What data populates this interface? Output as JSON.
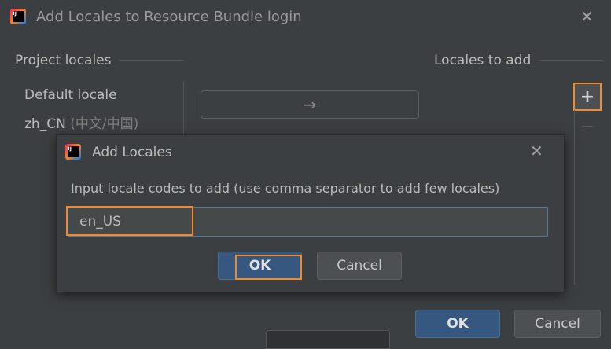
{
  "main_dialog": {
    "title": "Add Locales to Resource Bundle login",
    "close_icon": "close-icon",
    "project_locales_label": "Project locales",
    "locales_to_add_label": "Locales to add",
    "project_locales": [
      {
        "code": "Default locale",
        "native": ""
      },
      {
        "code": "zh_CN",
        "native": "(中文/中国)"
      }
    ],
    "arrow_glyph": "→",
    "plus_glyph": "+",
    "minus_glyph": "−",
    "ok_label": "OK",
    "cancel_label": "Cancel"
  },
  "sub_dialog": {
    "title": "Add Locales",
    "close_icon": "close-icon",
    "prompt": "Input locale codes to add (use comma separator to add few locales)",
    "input_value": "en_US",
    "ok_label": "OK",
    "cancel_label": "Cancel"
  },
  "logo_text": "IJ",
  "colors": {
    "background": "#3c3f41",
    "highlight": "#f08c2e",
    "primary_button": "#365880"
  }
}
